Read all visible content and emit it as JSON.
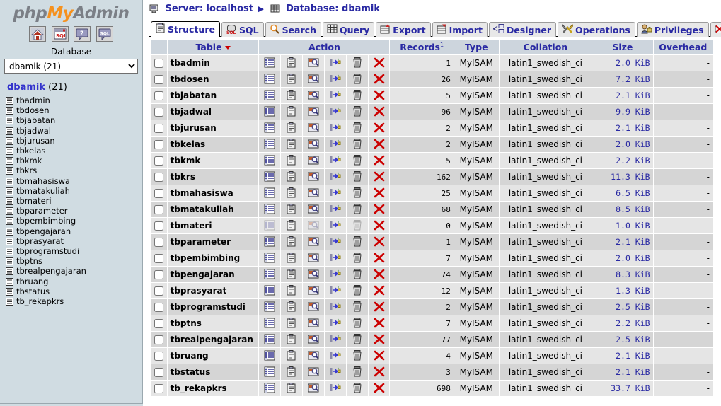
{
  "sidebar": {
    "logo": {
      "php": "php",
      "my": "My",
      "admin": "Admin"
    },
    "toolbar": [
      {
        "name": "home-icon",
        "title": "Home"
      },
      {
        "name": "sql-window-icon",
        "title": "Query window"
      },
      {
        "name": "help-icon",
        "title": "phpMyAdmin documentation"
      },
      {
        "name": "sql-help-icon",
        "title": "MySQL documentation"
      }
    ],
    "database_label": "Database",
    "database_select": {
      "value": "dbamik (21)",
      "options": [
        "dbamik (21)"
      ]
    },
    "db_title": {
      "name": "dbamik",
      "count": "(21)"
    },
    "tables": [
      "tbadmin",
      "tbdosen",
      "tbjabatan",
      "tbjadwal",
      "tbjurusan",
      "tbkelas",
      "tbkmk",
      "tbkrs",
      "tbmahasiswa",
      "tbmatakuliah",
      "tbmateri",
      "tbparameter",
      "tbpembimbing",
      "tbpengajaran",
      "tbprasyarat",
      "tbprogramstudi",
      "tbptns",
      "tbrealpengajaran",
      "tbruang",
      "tbstatus",
      "tb_rekapkrs"
    ]
  },
  "breadcrumb": {
    "server_label": "Server: localhost",
    "separator": "▶",
    "database_label": "Database: dbamik"
  },
  "tabs": [
    {
      "label": "Structure",
      "icon": "structure-icon",
      "active": true,
      "drop": false
    },
    {
      "label": "SQL",
      "icon": "sql-icon",
      "active": false,
      "drop": false
    },
    {
      "label": "Search",
      "icon": "search-icon",
      "active": false,
      "drop": false
    },
    {
      "label": "Query",
      "icon": "query-icon",
      "active": false,
      "drop": false
    },
    {
      "label": "Export",
      "icon": "export-icon",
      "active": false,
      "drop": false
    },
    {
      "label": "Import",
      "icon": "import-icon",
      "active": false,
      "drop": false
    },
    {
      "label": "Designer",
      "icon": "designer-icon",
      "active": false,
      "drop": false
    },
    {
      "label": "Operations",
      "icon": "operations-icon",
      "active": false,
      "drop": false
    },
    {
      "label": "Privileges",
      "icon": "privileges-icon",
      "active": false,
      "drop": false
    },
    {
      "label": "Drop",
      "icon": "drop-icon",
      "active": false,
      "drop": true
    }
  ],
  "table": {
    "headers": {
      "check": "",
      "name": "Table",
      "action": "Action",
      "records": "Records",
      "records_sup": "1",
      "type": "Type",
      "collation": "Collation",
      "size": "Size",
      "overhead": "Overhead"
    },
    "action_icons": [
      "browse-icon",
      "structure-icon",
      "search-icon",
      "insert-icon",
      "empty-icon",
      "drop-icon"
    ],
    "rows": [
      {
        "name": "tbadmin",
        "records": "1",
        "type": "MyISAM",
        "collation": "latin1_swedish_ci",
        "size": "2.0 KiB",
        "overhead": "-",
        "disabled": false
      },
      {
        "name": "tbdosen",
        "records": "26",
        "type": "MyISAM",
        "collation": "latin1_swedish_ci",
        "size": "7.2 KiB",
        "overhead": "-",
        "disabled": false
      },
      {
        "name": "tbjabatan",
        "records": "5",
        "type": "MyISAM",
        "collation": "latin1_swedish_ci",
        "size": "2.1 KiB",
        "overhead": "-",
        "disabled": false
      },
      {
        "name": "tbjadwal",
        "records": "96",
        "type": "MyISAM",
        "collation": "latin1_swedish_ci",
        "size": "9.9 KiB",
        "overhead": "-",
        "disabled": false
      },
      {
        "name": "tbjurusan",
        "records": "2",
        "type": "MyISAM",
        "collation": "latin1_swedish_ci",
        "size": "2.1 KiB",
        "overhead": "-",
        "disabled": false
      },
      {
        "name": "tbkelas",
        "records": "2",
        "type": "MyISAM",
        "collation": "latin1_swedish_ci",
        "size": "2.0 KiB",
        "overhead": "-",
        "disabled": false
      },
      {
        "name": "tbkmk",
        "records": "5",
        "type": "MyISAM",
        "collation": "latin1_swedish_ci",
        "size": "2.2 KiB",
        "overhead": "-",
        "disabled": false
      },
      {
        "name": "tbkrs",
        "records": "162",
        "type": "MyISAM",
        "collation": "latin1_swedish_ci",
        "size": "11.3 KiB",
        "overhead": "-",
        "disabled": false
      },
      {
        "name": "tbmahasiswa",
        "records": "25",
        "type": "MyISAM",
        "collation": "latin1_swedish_ci",
        "size": "6.5 KiB",
        "overhead": "-",
        "disabled": false
      },
      {
        "name": "tbmatakuliah",
        "records": "68",
        "type": "MyISAM",
        "collation": "latin1_swedish_ci",
        "size": "8.5 KiB",
        "overhead": "-",
        "disabled": false
      },
      {
        "name": "tbmateri",
        "records": "0",
        "type": "MyISAM",
        "collation": "latin1_swedish_ci",
        "size": "1.0 KiB",
        "overhead": "-",
        "disabled": true
      },
      {
        "name": "tbparameter",
        "records": "1",
        "type": "MyISAM",
        "collation": "latin1_swedish_ci",
        "size": "2.1 KiB",
        "overhead": "-",
        "disabled": false
      },
      {
        "name": "tbpembimbing",
        "records": "7",
        "type": "MyISAM",
        "collation": "latin1_swedish_ci",
        "size": "2.0 KiB",
        "overhead": "-",
        "disabled": false
      },
      {
        "name": "tbpengajaran",
        "records": "74",
        "type": "MyISAM",
        "collation": "latin1_swedish_ci",
        "size": "8.3 KiB",
        "overhead": "-",
        "disabled": false
      },
      {
        "name": "tbprasyarat",
        "records": "12",
        "type": "MyISAM",
        "collation": "latin1_swedish_ci",
        "size": "1.3 KiB",
        "overhead": "-",
        "disabled": false
      },
      {
        "name": "tbprogramstudi",
        "records": "2",
        "type": "MyISAM",
        "collation": "latin1_swedish_ci",
        "size": "2.5 KiB",
        "overhead": "-",
        "disabled": false
      },
      {
        "name": "tbptns",
        "records": "7",
        "type": "MyISAM",
        "collation": "latin1_swedish_ci",
        "size": "2.2 KiB",
        "overhead": "-",
        "disabled": false
      },
      {
        "name": "tbrealpengajaran",
        "records": "77",
        "type": "MyISAM",
        "collation": "latin1_swedish_ci",
        "size": "2.5 KiB",
        "overhead": "-",
        "disabled": false
      },
      {
        "name": "tbruang",
        "records": "4",
        "type": "MyISAM",
        "collation": "latin1_swedish_ci",
        "size": "2.1 KiB",
        "overhead": "-",
        "disabled": false
      },
      {
        "name": "tbstatus",
        "records": "3",
        "type": "MyISAM",
        "collation": "latin1_swedish_ci",
        "size": "2.1 KiB",
        "overhead": "-",
        "disabled": false
      },
      {
        "name": "tb_rekapkrs",
        "records": "698",
        "type": "MyISAM",
        "collation": "latin1_swedish_ci",
        "size": "33.7 KiB",
        "overhead": "-",
        "disabled": false
      }
    ]
  },
  "colors": {
    "sidebar_bg": "#d0dce2",
    "link": "#2929a3",
    "drop_red": "#cc0000",
    "row_odd": "#e5e5e5",
    "row_even": "#d5d5d5",
    "header_bg": "#cdd5dd",
    "logo_orange": "#f5911e"
  }
}
